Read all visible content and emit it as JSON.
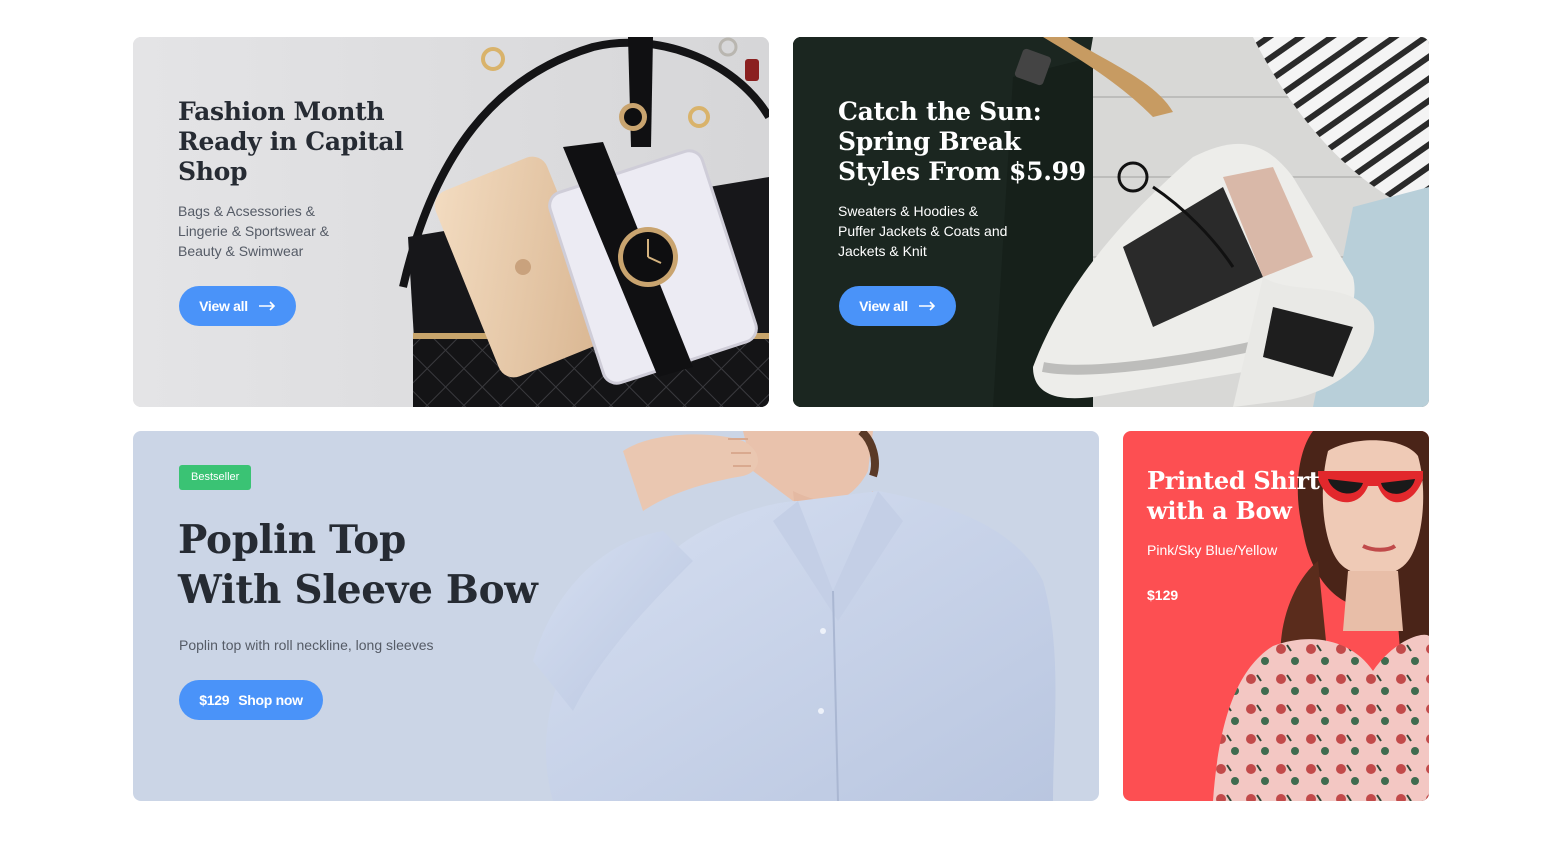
{
  "banners": {
    "fashion": {
      "title_lines": [
        "Fashion Month",
        "Ready in Capital",
        "Shop"
      ],
      "sub_lines": [
        "Bags & Acsessories &",
        "Lingerie & Sportswear &",
        "Beauty & Swimwear"
      ],
      "button_label": "View all",
      "button_icon": "arrow-right-icon",
      "image": "handbag-watch-phone-photo"
    },
    "sun": {
      "title_lines": [
        "Catch the Sun:",
        "Spring Break",
        "Styles From $5.99"
      ],
      "sub_lines": [
        "Sweaters & Hoodies &",
        "Puffer Jackets & Coats and",
        "Jackets & Knit"
      ],
      "button_label": "View all",
      "button_icon": "arrow-right-icon",
      "image": "sneakers-jacket-photo"
    },
    "poplin": {
      "badge": "Bestseller",
      "title_lines": [
        "Poplin Top",
        "With Sleeve Bow"
      ],
      "description": "Poplin top with roll neckline, long sleeves",
      "price": "$129",
      "button_label": "Shop now",
      "image": "woman-blue-shirt-photo"
    },
    "printed": {
      "title_lines": [
        "Printed Shirt",
        "with a Bow"
      ],
      "colors": "Pink/Sky Blue/Yellow",
      "price": "$129",
      "image": "woman-red-sunglasses-photo"
    }
  },
  "colors": {
    "accent_blue": "#4a93f9",
    "badge_green": "#3ac374",
    "poplin_bg": "#cbd5e6",
    "printed_bg": "#fd4f52",
    "title_dark": "#262b33"
  }
}
